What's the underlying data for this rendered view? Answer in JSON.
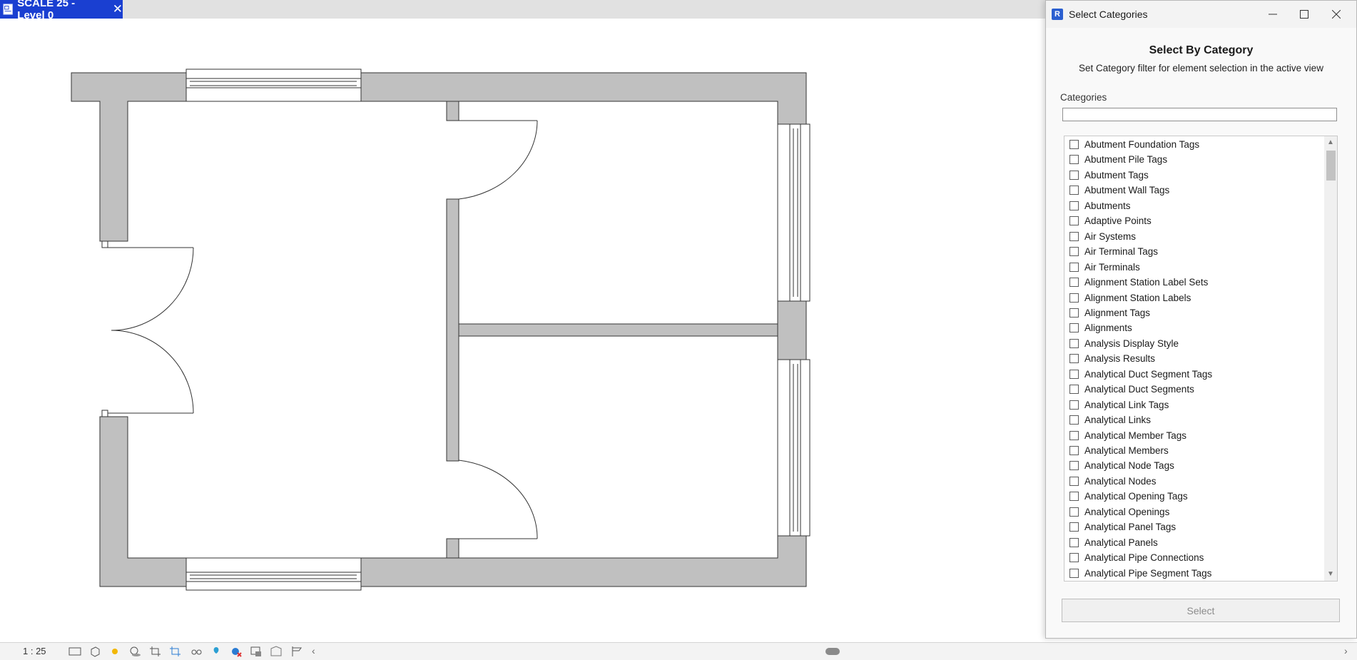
{
  "view_tab": {
    "title": "SCALE 25 - Level 0",
    "close": "✕"
  },
  "status_bar": {
    "scale": "1 : 25"
  },
  "dialog": {
    "title": "Select Categories",
    "heading": "Select By Category",
    "subheading": "Set Category filter for element selection in the active view",
    "categories_label": "Categories",
    "filter_value": "",
    "select_label": "Select",
    "items": [
      "Abutment Foundation Tags",
      "Abutment Pile Tags",
      "Abutment Tags",
      "Abutment Wall Tags",
      "Abutments",
      "Adaptive Points",
      "Air Systems",
      "Air Terminal Tags",
      "Air Terminals",
      "Alignment Station Label Sets",
      "Alignment Station Labels",
      "Alignment Tags",
      "Alignments",
      "Analysis Display Style",
      "Analysis Results",
      "Analytical Duct Segment Tags",
      "Analytical Duct Segments",
      "Analytical Link Tags",
      "Analytical Links",
      "Analytical Member Tags",
      "Analytical Members",
      "Analytical Node Tags",
      "Analytical Nodes",
      "Analytical Opening Tags",
      "Analytical Openings",
      "Analytical Panel Tags",
      "Analytical Panels",
      "Analytical Pipe Connections",
      "Analytical Pipe Segment Tags"
    ]
  },
  "colors": {
    "tab_active": "#1a3fd1",
    "wall_fill": "#c0c0c0"
  }
}
